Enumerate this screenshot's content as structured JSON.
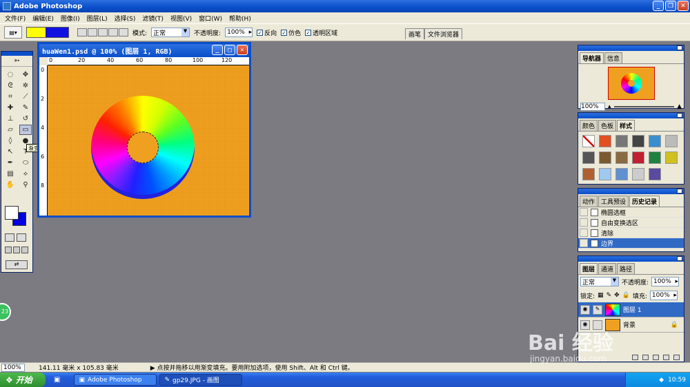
{
  "window": {
    "title": "Adobe Photoshop"
  },
  "menu": [
    "文件(F)",
    "编辑(E)",
    "图像(I)",
    "图层(L)",
    "选择(S)",
    "滤镜(T)",
    "视图(V)",
    "窗口(W)",
    "帮助(H)"
  ],
  "options": {
    "mode_label": "模式:",
    "mode_value": "正常",
    "opacity_label": "不透明度:",
    "opacity_value": "100%",
    "reverse_label": "反向",
    "dither_label": "仿色",
    "transparency_label": "透明区域",
    "gradient_colors": [
      "#ffff00",
      "#1010e0"
    ]
  },
  "well_tabs": [
    "画笔",
    "文件浏览器"
  ],
  "tooltip": "渐变工具 (G)",
  "document": {
    "title": "huaWen1.psd @ 100% (图层 1, RGB)",
    "ruler_h": [
      "0",
      "20",
      "40",
      "60",
      "80",
      "100",
      "120"
    ],
    "ruler_v": [
      "0",
      "2",
      "4",
      "6",
      "8"
    ]
  },
  "navigator": {
    "tabs": [
      "导航器",
      "信息"
    ],
    "zoom": "100%"
  },
  "styles": {
    "tabs": [
      "颜色",
      "色板",
      "样式"
    ]
  },
  "history": {
    "tabs": [
      "动作",
      "工具预设",
      "历史记录"
    ],
    "items": [
      "椭圆选框",
      "自由变换选区",
      "清除",
      "边界"
    ]
  },
  "layers": {
    "tabs": [
      "图层",
      "通道",
      "路径"
    ],
    "blend": "正常",
    "opacity_label": "不透明度:",
    "opacity": "100%",
    "lock_label": "锁定:",
    "fill_label": "填充:",
    "fill": "100%",
    "items": [
      {
        "name": "图层 1"
      },
      {
        "name": "背景"
      }
    ]
  },
  "status": {
    "zoom": "100%",
    "size": "141.11 毫米 x 105.83 毫米",
    "hint": "▶ 点按并拖移以用渐变填充。要用附加选项，使用 Shift、Alt 和 Ctrl 键。"
  },
  "taskbar": {
    "start": "开始",
    "tasks": [
      "Adobe Photoshop",
      "gp29.JPG - 画图"
    ],
    "clock": "10:59"
  },
  "watermark": {
    "main": "Bai 经验",
    "sub": "jingyan.baidu.com"
  },
  "badge": "23"
}
